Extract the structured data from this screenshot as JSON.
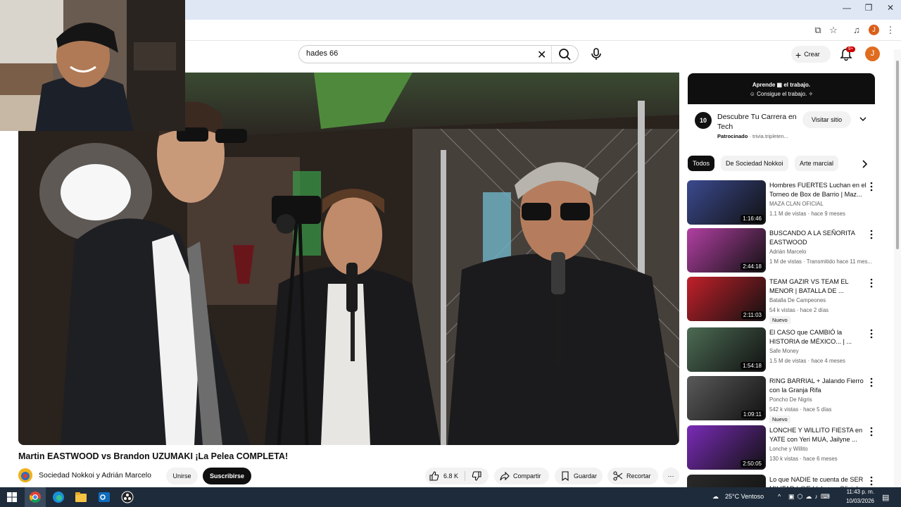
{
  "search": {
    "query": "hades 66"
  },
  "header": {
    "create_label": "Crear",
    "notif_count": "9+",
    "avatar_letter": "J"
  },
  "browser": {
    "profile_letter": "J"
  },
  "video": {
    "title": "Martin EASTWOOD vs Brandon UZUMAKI ¡La Pelea COMPLETA!",
    "channel": "Sociedad Nokkoi y Adrián Marcelo",
    "join_label": "Unirse",
    "subscribe_label": "Suscribirse",
    "likes": "6.8 K",
    "share_label": "Compartir",
    "save_label": "Guardar",
    "clip_label": "Recortar"
  },
  "ad": {
    "banner_line1": "Aprende ▦ el trabajo.",
    "banner_line2": "☺ Consigue el trabajo. ✧",
    "logo_text": "10",
    "title": "Descubre Tu Carrera en Tech",
    "sponsored": "Patrocinado",
    "domain": "· trivia.tripleten...",
    "visit_label": "Visitar sitio"
  },
  "chips": [
    "Todos",
    "De Sociedad Nokkoi",
    "Arte marcial"
  ],
  "recommendations": [
    {
      "title": "Hombres FUERTES Luchan en el Torneo de Box de Barrio | Maz...",
      "channel": "MAZA CLAN OFICIAL",
      "meta": "1.1 M de vistas · hace 9 meses",
      "duration": "1:16:46",
      "new": "",
      "thumb_color": "#3b4a8f"
    },
    {
      "title": "BUSCANDO A LA SEÑORITA EASTWOOD",
      "channel": "Adrián Marcelo",
      "meta": "1 M de vistas · Transmitido hace 11 mes...",
      "duration": "2:44:18",
      "new": "",
      "thumb_color": "#b23fa3"
    },
    {
      "title": "TEAM GAZIR VS TEAM EL MENOR | BATALLA DE ...",
      "channel": "Batalla De Campeones",
      "meta": "54 k vistas · hace 2 días",
      "duration": "2:11:03",
      "new": "Nuevo",
      "thumb_color": "#c2202a"
    },
    {
      "title": "El CASO que CAMBIÓ la HISTORIA de MÉXICO... | ...",
      "channel": "Safe Money",
      "meta": "1.5 M de vistas · hace 4 meses",
      "duration": "1:54:18",
      "new": "",
      "thumb_color": "#4c6b54"
    },
    {
      "title": "RING BARRIAL + Jalando Fierro con la Granja Rifa",
      "channel": "Poncho De Nigris",
      "meta": "542 k vistas · hace 5 días",
      "duration": "1:09:11",
      "new": "Nuevo",
      "thumb_color": "#5a5a5a"
    },
    {
      "title": "LONCHE Y WILLITO FIESTA en YATE con Yeri MUA, Jailyne ...",
      "channel": "Lonche y Willito",
      "meta": "130 k vistas · hace 6 meses",
      "duration": "2:50:05",
      "new": "",
      "thumb_color": "#7a2bb8"
    },
    {
      "title": "Lo que NADIE te cuenta de SER MILITAR | @EddyberronOficial",
      "channel": "",
      "meta": "",
      "duration": "",
      "new": "",
      "thumb_color": "#2a2a2a"
    }
  ],
  "taskbar": {
    "weather": "25°C  Ventoso",
    "time": "11:43 p. m.",
    "date": "10/03/2026"
  }
}
